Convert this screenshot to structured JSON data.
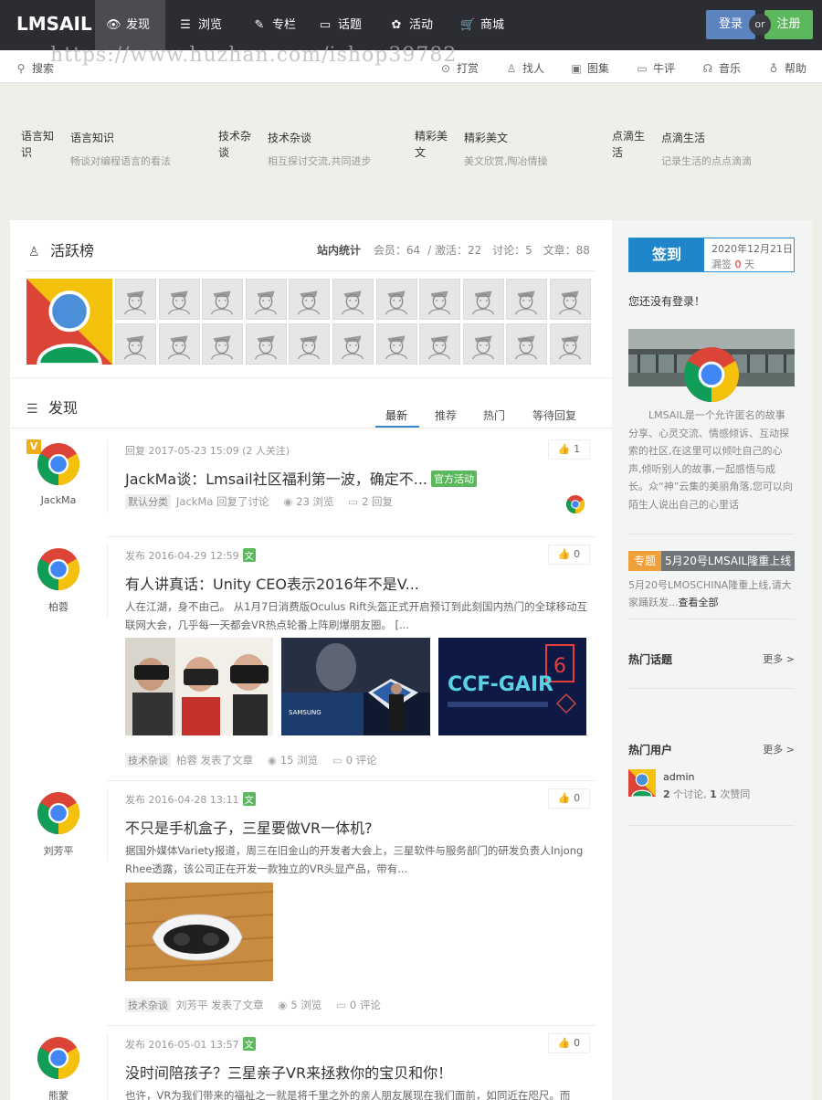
{
  "brand": {
    "logo": "LMSAIL"
  },
  "nav": {
    "items": [
      {
        "icon": "eye-icon",
        "label": "发现"
      },
      {
        "icon": "list-icon",
        "label": "浏览"
      },
      {
        "icon": "pen-icon",
        "label": "专栏"
      },
      {
        "icon": "chat-icon",
        "label": "话题"
      },
      {
        "icon": "activity-icon",
        "label": "活动"
      },
      {
        "icon": "cart-icon",
        "label": "商城"
      }
    ],
    "login": "登录",
    "or": "or",
    "register": "注册"
  },
  "subbar": {
    "search": "搜索",
    "items": [
      {
        "icon": "gift-icon",
        "label": "打赏"
      },
      {
        "icon": "user-icon",
        "label": "找人"
      },
      {
        "icon": "picture-icon",
        "label": "图集"
      },
      {
        "icon": "comment-icon",
        "label": "牛评"
      },
      {
        "icon": "headphones-icon",
        "label": "音乐"
      },
      {
        "icon": "bulb-icon",
        "label": "帮助"
      }
    ],
    "watermark": "https://www.huzhan.com/ishop39782"
  },
  "categories": [
    {
      "thumb": "语言知识",
      "name": "语言知识",
      "desc": "畅谈对编程语言的看法"
    },
    {
      "thumb": "技术杂谈",
      "name": "技术杂谈",
      "desc": "相互探讨交流,共同进步"
    },
    {
      "thumb": "精彩美文",
      "name": "精彩美文",
      "desc": "美文欣赏,陶冶情操"
    },
    {
      "thumb": "点滴生活",
      "name": "点滴生活",
      "desc": "记录生活的点点滴滴"
    }
  ],
  "active": {
    "title": "活跃榜",
    "stats_label": "站内统计",
    "members": "会员：64",
    "activated": "激活：22",
    "discussions": "讨论：5",
    "articles": "文章：88"
  },
  "discover": {
    "title": "发现",
    "tabs": [
      "最新",
      "推荐",
      "热门",
      "等待回复"
    ]
  },
  "posts": [
    {
      "user": "JackMa",
      "badge": "V",
      "meta": "回复 2017-05-23 15:09 (2 人关注)",
      "title": "JackMa谈：Lmsail社区福利第一波，确定不...",
      "tag": "官方活动",
      "likes": "1",
      "category": "默认分类",
      "action": "JackMa 回复了讨论",
      "views": "23 浏览",
      "comments": "2 回复"
    },
    {
      "user": "柏蓉",
      "meta": "发布 2016-04-29 12:59",
      "wen": "文",
      "title": "有人讲真话：Unity CEO表示2016年不是V...",
      "excerpt": "人在江湖，身不由己。 从1月7日消费版Oculus Rift头盔正式开启预订到此刻国内热门的全球移动互联网大会，几乎每一天都会VR热点轮番上阵刷爆朋友圈。 [...",
      "likes": "0",
      "category": "技术杂谈",
      "action": "柏蓉 发表了文章",
      "views": "15 浏览",
      "comments": "0 评论",
      "images": [
        "SAMSUNG",
        "CCF-GAIR"
      ]
    },
    {
      "user": "刘芳平",
      "meta": "发布 2016-04-28 13:11",
      "wen": "文",
      "title": "不只是手机盒子，三星要做VR一体机?",
      "excerpt": "据国外媒体Variety报道，周三在旧金山的开发者大会上，三星软件与服务部门的研发负责人Injong Rhee透露，该公司正在开发一款独立的VR头显产品，带有...",
      "likes": "0",
      "category": "技术杂谈",
      "action": "刘芳平 发表了文章",
      "views": "5 浏览",
      "comments": "0 评论"
    },
    {
      "user": "熊蒙",
      "meta": "发布 2016-05-01 13:57",
      "wen": "文",
      "title": "没时间陪孩子？三星亲子VR来拯救你的宝贝和你！",
      "excerpt": "也许，VR为我们带来的福祉之一就是将千里之外的亲人朋友展现在我们面前，如同近在咫尺。而",
      "likes": "0"
    }
  ],
  "sidebar": {
    "signin": "签到",
    "date": "2020年12月21日",
    "missed_prefix": "漏签",
    "missed_count": "0",
    "missed_suffix": "天",
    "not_logged": "您还没有登录！",
    "intro": "LMSAIL是一个允许匿名的故事分享、心灵交流、情感倾诉、互动探索的社区,在这里可以倾吐自己的心声,倾听别人的故事,一起感悟与成长。众“神”云集的美丽角落,您可以向陌生人说出自己的心里话",
    "topic_tag": "专题",
    "topic_title": "5月20号LMSAIL隆重上线",
    "topic_desc": "5月20号LMOSCHINA隆重上线,请大家踊跃发...",
    "topic_more": "查看全部",
    "hot_topics": "热门话题",
    "hot_users": "热门用户",
    "more": "更多 >",
    "hot_user_name": "admin",
    "hot_user_disc_count": "2",
    "hot_user_disc_label": "个讨论,",
    "hot_user_like_count": "1",
    "hot_user_like_label": "次赞同"
  },
  "colors": {
    "nav_bg": "#2c2d32",
    "login": "#5b83c0",
    "register": "#5cb85c",
    "signin": "#1f86cc",
    "topic_tag": "#f0a03a"
  }
}
